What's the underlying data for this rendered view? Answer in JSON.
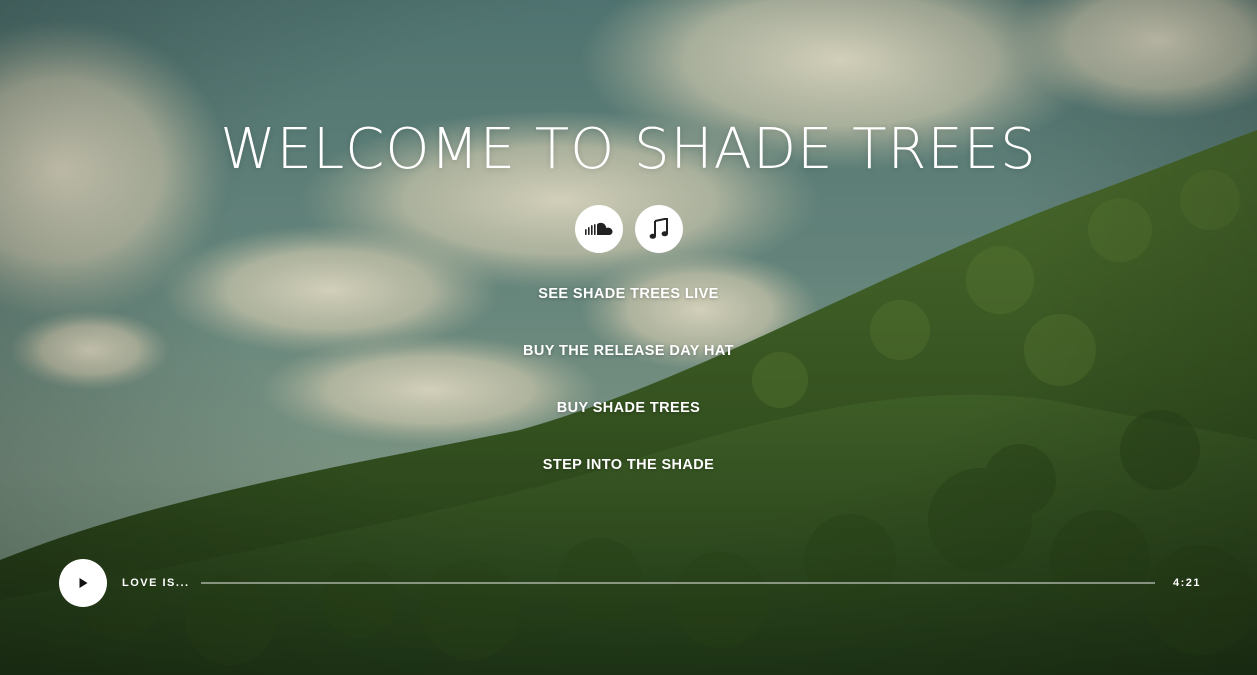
{
  "hero": {
    "title": "WELCOME TO SHADE TREES"
  },
  "social": [
    {
      "icon": "soundcloud-icon"
    },
    {
      "icon": "music-note-icon"
    }
  ],
  "nav": {
    "items": [
      {
        "label": "SEE SHADE TREES LIVE"
      },
      {
        "label": "BUY THE RELEASE DAY HAT"
      },
      {
        "label": "BUY SHADE TREES"
      },
      {
        "label": "STEP INTO THE SHADE"
      }
    ]
  },
  "player": {
    "play_icon": "play-icon",
    "track_title": "LOVE IS...",
    "duration": "4:21",
    "progress": 0
  },
  "colors": {
    "text": "#ffffff",
    "sky": "#5b7c78",
    "forest": "#2f4a23"
  }
}
